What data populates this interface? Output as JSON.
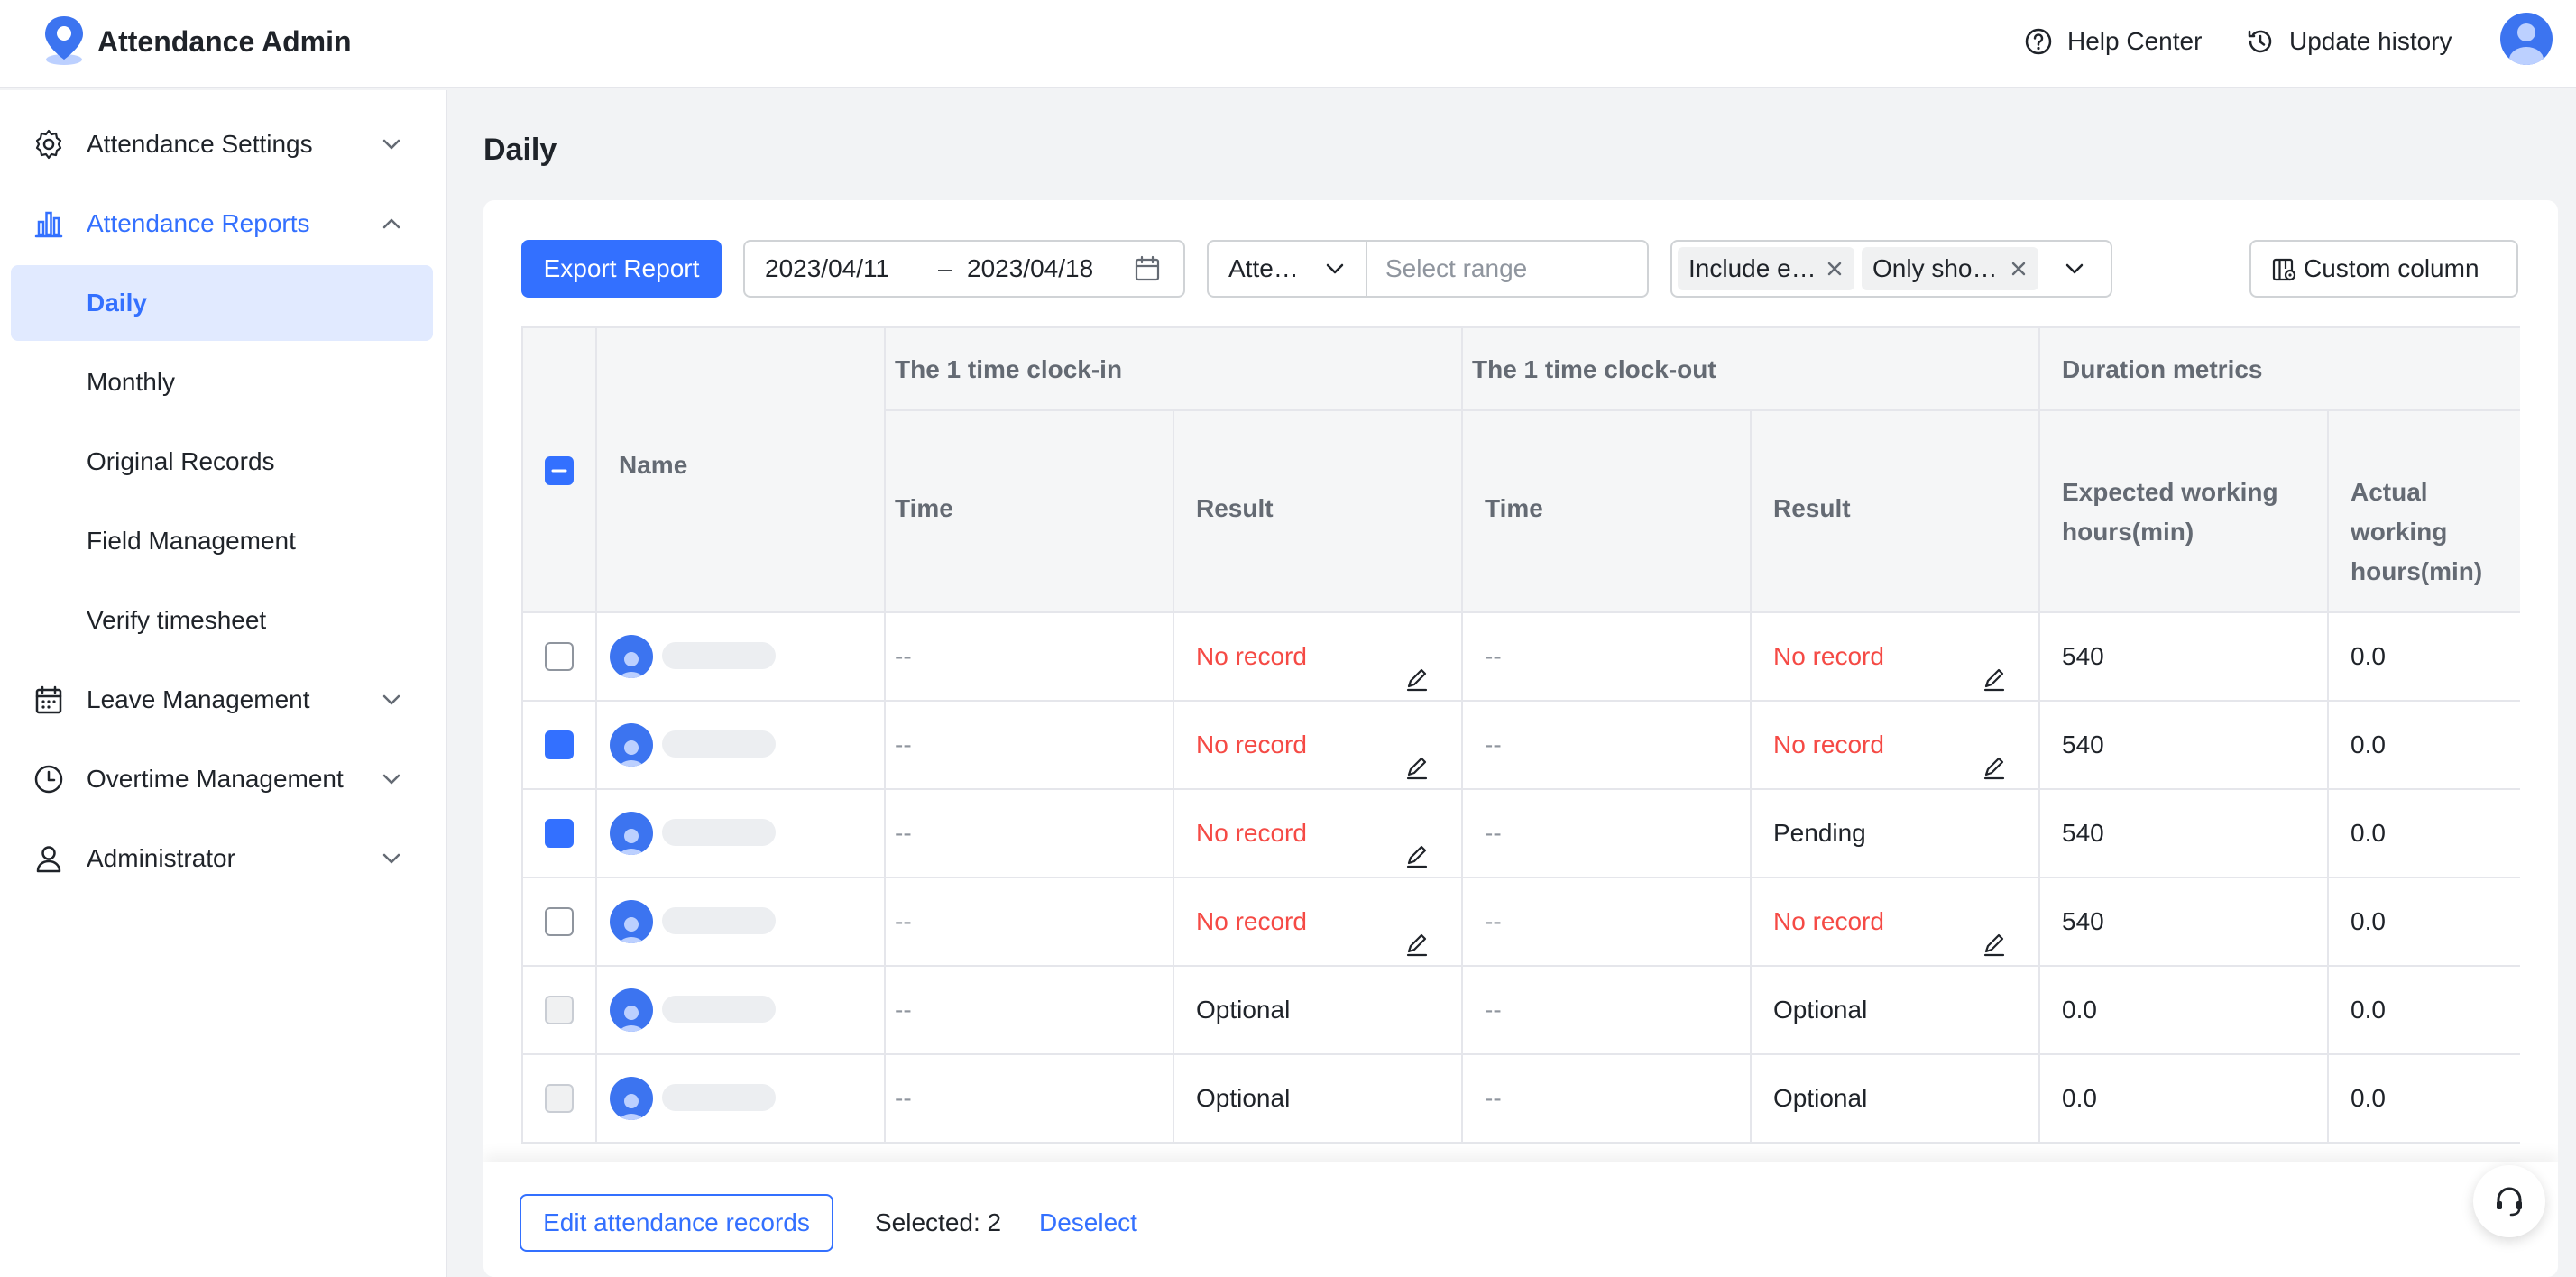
{
  "app": {
    "title": "Attendance Admin"
  },
  "header": {
    "help_label": "Help Center",
    "history_label": "Update history"
  },
  "sidebar": {
    "items": [
      {
        "label": "Attendance Settings",
        "icon": "gear-icon"
      },
      {
        "label": "Attendance Reports",
        "icon": "bar-chart-icon"
      },
      {
        "label": "Leave Management",
        "icon": "calendar-icon"
      },
      {
        "label": "Overtime Management",
        "icon": "clock-icon"
      },
      {
        "label": "Administrator",
        "icon": "user-icon"
      }
    ],
    "report_sub": [
      "Daily",
      "Monthly",
      "Original Records",
      "Field Management",
      "Verify timesheet"
    ]
  },
  "page": {
    "title": "Daily"
  },
  "toolbar": {
    "export_label": "Export Report",
    "date_start": "2023/04/11",
    "date_sep": "–",
    "date_end": "2023/04/18",
    "type_value": "Atte…",
    "range_placeholder": "Select range",
    "tags": [
      "Include e…",
      "Only sho…"
    ],
    "custom_column_label": "Custom column"
  },
  "table": {
    "group_headers": [
      "The 1 time clock-in",
      "The 1 time clock-out",
      "Duration metrics"
    ],
    "name_header": "Name",
    "sub_headers": [
      "Time",
      "Result",
      "Time",
      "Result",
      "Expected working hours(min)",
      "Actual working hours(min)"
    ],
    "rows": [
      {
        "checked": false,
        "disabled": false,
        "in_time": "--",
        "in_result": "No record",
        "in_red": true,
        "in_edit": true,
        "out_time": "--",
        "out_result": "No record",
        "out_red": true,
        "out_edit": true,
        "expected": "540",
        "actual": "0.0"
      },
      {
        "checked": true,
        "disabled": false,
        "in_time": "--",
        "in_result": "No record",
        "in_red": true,
        "in_edit": true,
        "out_time": "--",
        "out_result": "No record",
        "out_red": true,
        "out_edit": true,
        "expected": "540",
        "actual": "0.0"
      },
      {
        "checked": true,
        "disabled": false,
        "in_time": "--",
        "in_result": "No record",
        "in_red": true,
        "in_edit": true,
        "out_time": "--",
        "out_result": "Pending",
        "out_red": false,
        "out_edit": false,
        "expected": "540",
        "actual": "0.0"
      },
      {
        "checked": false,
        "disabled": false,
        "in_time": "--",
        "in_result": "No record",
        "in_red": true,
        "in_edit": true,
        "out_time": "--",
        "out_result": "No record",
        "out_red": true,
        "out_edit": true,
        "expected": "540",
        "actual": "0.0"
      },
      {
        "checked": false,
        "disabled": true,
        "in_time": "--",
        "in_result": "Optional",
        "in_red": false,
        "in_edit": false,
        "out_time": "--",
        "out_result": "Optional",
        "out_red": false,
        "out_edit": false,
        "expected": "0.0",
        "actual": "0.0"
      },
      {
        "checked": false,
        "disabled": true,
        "in_time": "--",
        "in_result": "Optional",
        "in_red": false,
        "in_edit": false,
        "out_time": "--",
        "out_result": "Optional",
        "out_red": false,
        "out_edit": false,
        "expected": "0.0",
        "actual": "0.0"
      }
    ]
  },
  "footer": {
    "edit_label": "Edit attendance records",
    "selected_text": "Selected: 2",
    "deselect_label": "Deselect"
  },
  "colors": {
    "accent": "#3370ff",
    "error": "#f54a45"
  }
}
